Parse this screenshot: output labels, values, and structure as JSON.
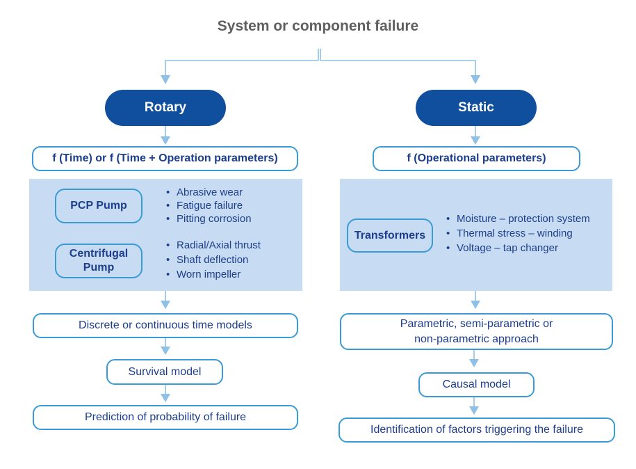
{
  "title": "System or component failure",
  "colors": {
    "category_fill": "#0f4f9d",
    "box_border": "#3a9ad6",
    "box_text": "#1d3e8c",
    "panel_fill": "#c7dcf2",
    "connector": "#8fc0e6",
    "title_text": "#5f5f5f"
  },
  "rotary": {
    "label": "Rotary",
    "function": "f (Time) or f (Time + Operation parameters)",
    "equipment": [
      {
        "name": "PCP Pump",
        "failures": [
          "Abrasive wear",
          "Fatigue failure",
          "Pitting corrosion"
        ]
      },
      {
        "name": "Centrifugal Pump",
        "failures": [
          "Radial/Axial thrust",
          "Shaft deflection",
          "Worn impeller"
        ]
      }
    ],
    "model_type": "Discrete or continuous time models",
    "model": "Survival model",
    "outcome": "Prediction of probability of failure"
  },
  "static": {
    "label": "Static",
    "function": "f (Operational parameters)",
    "equipment": [
      {
        "name": "Transformers",
        "failures": [
          "Moisture – protection system",
          "Thermal stress – winding",
          "Voltage – tap changer"
        ]
      }
    ],
    "approach_line1": "Parametric, semi-parametric or",
    "approach_line2": "non-parametric approach",
    "model": "Causal model",
    "outcome": "Identification of factors triggering the failure"
  }
}
